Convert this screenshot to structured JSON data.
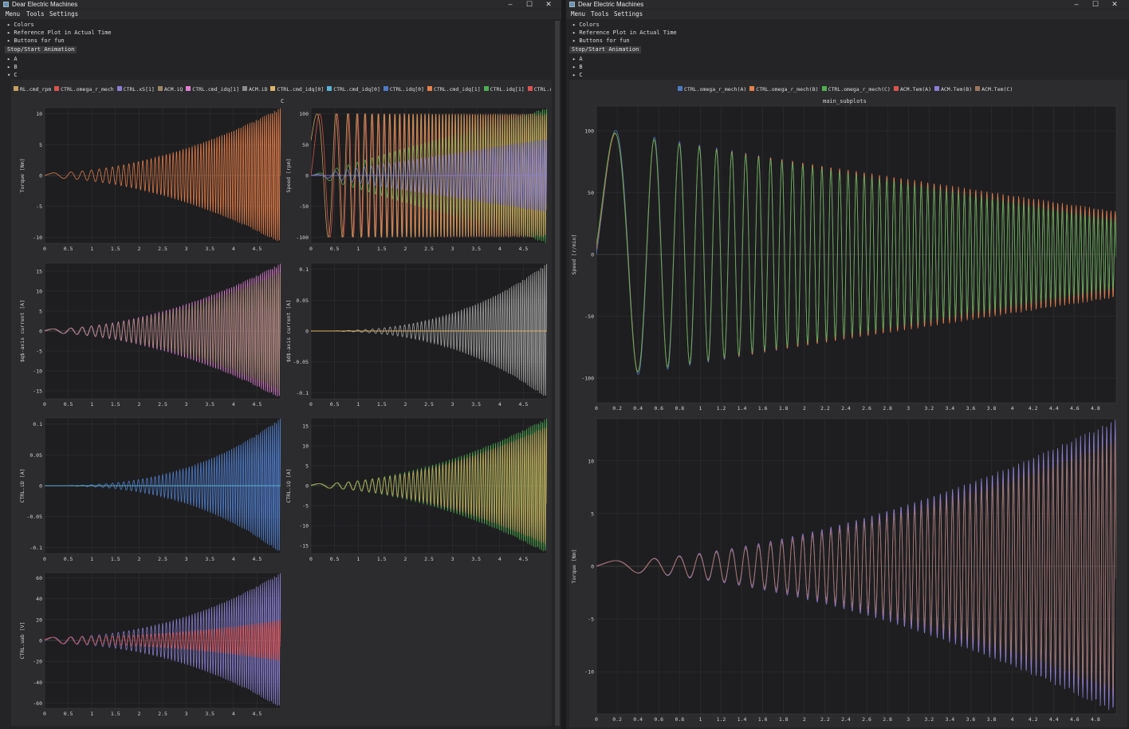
{
  "left_window": {
    "title": "Dear Electric Machines",
    "menu": [
      "Menu",
      "Tools",
      "Settings"
    ],
    "tree_top": [
      "▸ Colors",
      "▸ Reference Plot in Actual Time",
      "▸ Buttons for fun"
    ],
    "animation_button": "Stop/Start Animation",
    "tree_groups": [
      "▸ A",
      "▸ B",
      "▾ C"
    ],
    "legend": [
      {
        "label": "RL.cmd_rpm",
        "color": "#c7a35c"
      },
      {
        "label": "CTRL.omega_r_mech",
        "color": "#d9534f"
      },
      {
        "label": "CTRL.xS[1]",
        "color": "#8a7fd4"
      },
      {
        "label": "ACM.iQ",
        "color": "#9a8467"
      },
      {
        "label": "CTRL.cmd_idq[1]",
        "color": "#e07fd2"
      },
      {
        "label": "ACM.iD",
        "color": "#8c8c8c"
      },
      {
        "label": "CTRL.cmd_idq[0]",
        "color": "#d8b56a"
      },
      {
        "label": "CTRL.cmd_idq[0]",
        "color": "#59b3d6"
      },
      {
        "label": "CTRL.idq[0]",
        "color": "#4e79c4"
      },
      {
        "label": "CTRL.cmd_idq[1]",
        "color": "#e8804a"
      },
      {
        "label": "CTRL.idq[1]",
        "color": "#4caf50"
      },
      {
        "label": "CTRL.cmd_",
        "color": "#d9534f"
      }
    ],
    "subplot_title": "C"
  },
  "right_window": {
    "title": "Dear Electric Machines",
    "menu": [
      "Menu",
      "Tools",
      "Settings"
    ],
    "tree_top": [
      "▸ Colors",
      "▸ Reference Plot in Actual Time",
      "▸ Buttons for fun"
    ],
    "animation_button": "Stop/Start Animation",
    "tree_groups": [
      "▸ A",
      "▸ B",
      "▸ C"
    ],
    "legend": [
      {
        "label": "CTRL.omega_r_mech(A)",
        "color": "#4e79c4"
      },
      {
        "label": "CTRL.omega_r_mech(B)",
        "color": "#e8804a"
      },
      {
        "label": "CTRL.omega_r_mech(C)",
        "color": "#4caf50"
      },
      {
        "label": "ACM.Tem(A)",
        "color": "#d9534f"
      },
      {
        "label": "ACM.Tem(B)",
        "color": "#8a7fd4"
      },
      {
        "label": "ACM.Tem(C)",
        "color": "#9a7560"
      }
    ],
    "subplot_title": "main_subplots"
  },
  "chart_data": [
    {
      "id": "torque",
      "type": "line",
      "title": "",
      "xlabel": "",
      "ylabel": "Torque [Nm]",
      "ylim": [
        -11,
        11
      ],
      "yticks": [
        10,
        5,
        0,
        -5,
        -10
      ],
      "xticks": [
        "0",
        "0.5",
        "1",
        "1.5",
        "2",
        "2.5",
        "3",
        "3.5",
        "4",
        "4.5"
      ],
      "xlim": [
        0,
        5
      ],
      "series": [
        {
          "values_envelope": "chirp sweep growing to ±11 from t=0 to t=5",
          "color": "#e8804a"
        }
      ]
    },
    {
      "id": "speed",
      "type": "line",
      "title": "",
      "xlabel": "",
      "ylabel": "Speed [rpm]",
      "ylim": [
        -110,
        110
      ],
      "yticks": [
        100,
        50,
        0,
        -50,
        -100
      ],
      "xticks": [
        "0",
        "0.5",
        "1",
        "1.5",
        "2",
        "2.5",
        "3",
        "3.5",
        "4",
        "4.5"
      ],
      "xlim": [
        0,
        5
      ],
      "series": [
        {
          "color": "#d9534f"
        },
        {
          "color": "#4caf50"
        },
        {
          "color": "#c7a35c"
        },
        {
          "color": "#8a7fd4"
        }
      ]
    },
    {
      "id": "iq",
      "type": "line",
      "title": "",
      "xlabel": "",
      "ylabel": "$q$-axis current [A]",
      "ylim": [
        -17,
        17
      ],
      "yticks": [
        15,
        10,
        5,
        0,
        -5,
        -10,
        -15
      ],
      "xticks": [
        "0",
        "0.5",
        "1",
        "1.5",
        "2",
        "2.5",
        "3",
        "3.5",
        "4",
        "4.5"
      ],
      "xlim": [
        0,
        5
      ],
      "series": [
        {
          "color": "#e07fd2"
        },
        {
          "color": "#9a8467"
        }
      ]
    },
    {
      "id": "id",
      "type": "area",
      "title": "",
      "xlabel": "",
      "ylabel": "$d$-axis current [A]",
      "ylim": [
        -0.11,
        0.11
      ],
      "yticks": [
        0.1,
        0.05,
        0,
        -0.05,
        -0.1
      ],
      "xticks": [
        "0",
        "0.5",
        "1",
        "1.5",
        "2",
        "2.5",
        "3",
        "3.5",
        "4",
        "4.5"
      ],
      "xlim": [
        0,
        5
      ],
      "series": [
        {
          "color": "#9e9e9e"
        },
        {
          "color": "#d8b56a"
        }
      ]
    },
    {
      "id": "ctrl_id",
      "type": "area",
      "title": "",
      "xlabel": "",
      "ylabel": "CTRL.iD [A]",
      "ylim": [
        -0.11,
        0.11
      ],
      "yticks": [
        0.1,
        0.05,
        0,
        -0.05,
        -0.1
      ],
      "xticks": [
        "0",
        "0.5",
        "1",
        "1.5",
        "2",
        "2.5",
        "3",
        "3.5",
        "4",
        "4.5"
      ],
      "xlim": [
        0,
        5
      ],
      "series": [
        {
          "color": "#4e79c4"
        },
        {
          "color": "#59b3d6"
        }
      ]
    },
    {
      "id": "ctrl_iq",
      "type": "line",
      "title": "",
      "xlabel": "",
      "ylabel": "CTRL.iQ [A]",
      "ylim": [
        -17,
        17
      ],
      "yticks": [
        15,
        10,
        5,
        0,
        -5,
        -10,
        -15
      ],
      "xticks": [
        "0",
        "0.5",
        "1",
        "1.5",
        "2",
        "2.5",
        "3",
        "3.5",
        "4",
        "4.5"
      ],
      "xlim": [
        0,
        5
      ],
      "series": [
        {
          "color": "#4caf50"
        },
        {
          "color": "#c7a35c"
        }
      ]
    },
    {
      "id": "ctrl_uab",
      "type": "line",
      "title": "",
      "xlabel": "",
      "ylabel": "CTRL.uab [V]",
      "ylim": [
        -65,
        65
      ],
      "yticks": [
        60,
        40,
        20,
        0,
        -20,
        -40,
        -60
      ],
      "xticks": [
        "0",
        "0.5",
        "1",
        "1.5",
        "2",
        "2.5",
        "3",
        "3.5",
        "4",
        "4.5"
      ],
      "xlim": [
        0,
        5
      ],
      "series": [
        {
          "color": "#8a7fd4"
        },
        {
          "color": "#d9534f"
        }
      ]
    },
    {
      "id": "main_speed",
      "type": "line",
      "title": "",
      "xlabel": "",
      "ylabel": "Speed [r/min]",
      "ylim": [
        -120,
        120
      ],
      "yticks": [
        100,
        50,
        0,
        -50,
        -100
      ],
      "xticks": [
        "0",
        "0.2",
        "0.4",
        "0.6",
        "0.8",
        "1",
        "1.2",
        "1.4",
        "1.6",
        "1.8",
        "2",
        "2.2",
        "2.4",
        "2.6",
        "2.8",
        "3",
        "3.2",
        "3.4",
        "3.6",
        "3.8",
        "4",
        "4.2",
        "4.4",
        "4.6",
        "4.8"
      ],
      "xlim": [
        0,
        5
      ],
      "series": [
        {
          "name": "CTRL.omega_r_mech(A)",
          "color": "#4e79c4"
        },
        {
          "name": "CTRL.omega_r_mech(B)",
          "color": "#e8804a"
        },
        {
          "name": "CTRL.omega_r_mech(C)",
          "color": "#4caf50"
        }
      ]
    },
    {
      "id": "main_torque",
      "type": "line",
      "title": "",
      "xlabel": "",
      "ylabel": "Torque [Nm]",
      "ylim": [
        -14,
        14
      ],
      "yticks": [
        10,
        5,
        0,
        -5,
        -10
      ],
      "xticks": [
        "0",
        "0.2",
        "0.4",
        "0.6",
        "0.8",
        "1",
        "1.2",
        "1.4",
        "1.6",
        "1.8",
        "2",
        "2.2",
        "2.4",
        "2.6",
        "2.8",
        "3",
        "3.2",
        "3.4",
        "3.6",
        "3.8",
        "4",
        "4.2",
        "4.4",
        "4.6",
        "4.8"
      ],
      "xlim": [
        0,
        5
      ],
      "series": [
        {
          "name": "ACM.Tem(A)",
          "color": "#d9534f"
        },
        {
          "name": "ACM.Tem(B)",
          "color": "#8a7fd4"
        },
        {
          "name": "ACM.Tem(C)",
          "color": "#9a7560"
        }
      ]
    }
  ]
}
